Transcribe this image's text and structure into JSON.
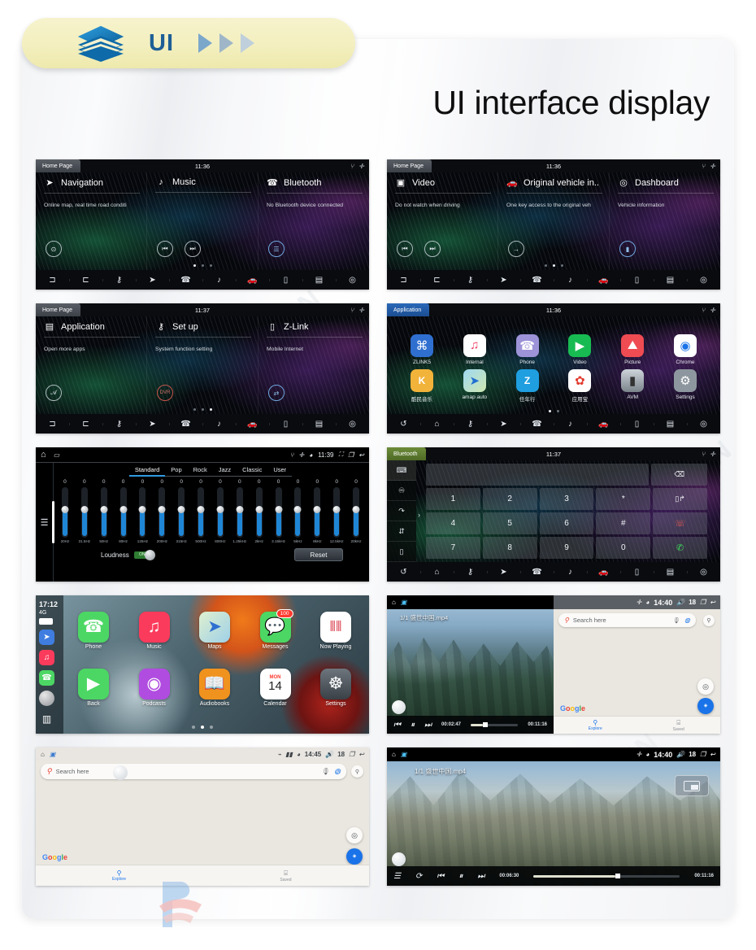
{
  "badge": {
    "label": "UI",
    "icon": "layers-stack-icon",
    "arrows": [
      "play-arrow-1",
      "play-arrow-2",
      "play-arrow-3"
    ]
  },
  "header": {
    "title": "UI interface display"
  },
  "watermarks": {
    "text": "ROADZHIYIN",
    "logo": "roadzhiyin-logo"
  },
  "screens": [
    {
      "id": "home-page-1",
      "tab": "Home Page",
      "clock": "11:36",
      "sysicons": [
        "usb-icon",
        "bluetooth-icon"
      ],
      "cards": [
        {
          "icon": "navigation-arrow-icon",
          "title": "Navigation",
          "sub": "Online map, real time road conditi",
          "buttons": [
            "location-pin-icon"
          ]
        },
        {
          "icon": "music-note-icon",
          "title": "Music",
          "sub": "",
          "buttons": [
            "prev-track-icon",
            "next-track-icon"
          ]
        },
        {
          "icon": "phone-handset-icon",
          "title": "Bluetooth",
          "sub": "No Bluetooth device connected",
          "buttons": [
            "call-list-icon"
          ]
        }
      ],
      "dots": 3,
      "active_dot": 0,
      "navbar": [
        "car-left-icon",
        "car-right-icon",
        "settings-key-icon",
        "navigation-icon",
        "phone-icon",
        "music-icon",
        "vehicle-icon",
        "link-phone-icon",
        "apps-icon",
        "dashboard-icon"
      ]
    },
    {
      "id": "home-page-2",
      "tab": "Home Page",
      "clock": "11:36",
      "sysicons": [
        "usb-icon",
        "bluetooth-icon"
      ],
      "cards": [
        {
          "icon": "video-icon",
          "title": "Video",
          "sub": "Do not watch when driving",
          "buttons": [
            "prev-track-icon",
            "next-track-icon"
          ]
        },
        {
          "icon": "vehicle-icon",
          "title": "Original vehicle in..",
          "sub": "One key access to the original veh",
          "buttons": [
            "exit-arrow-icon"
          ]
        },
        {
          "icon": "dashboard-icon",
          "title": "Dashboard",
          "sub": "Vehicle information",
          "buttons": [
            "equalizer-bars-icon"
          ]
        }
      ],
      "dots": 3,
      "active_dot": 1,
      "navbar": [
        "car-left-icon",
        "car-right-icon",
        "settings-key-icon",
        "navigation-icon",
        "phone-icon",
        "music-icon",
        "vehicle-icon",
        "link-phone-icon",
        "apps-icon",
        "dashboard-icon"
      ]
    },
    {
      "id": "home-page-3",
      "tab": "Home Page",
      "clock": "11:37",
      "sysicons": [
        "usb-icon",
        "bluetooth-icon"
      ],
      "cards": [
        {
          "icon": "apps-grid-icon",
          "title": "Application",
          "sub": "Open more apps",
          "buttons": [
            "app-store-icon"
          ]
        },
        {
          "icon": "settings-key-icon",
          "title": "Set up",
          "sub": "System function setting",
          "buttons": [
            "dvr-record-icon"
          ]
        },
        {
          "icon": "link-phone-icon",
          "title": "Z-Link",
          "sub": "Mobile Internet",
          "buttons": [
            "zlink-icon"
          ]
        }
      ],
      "dots": 3,
      "active_dot": 2,
      "navbar": [
        "car-left-icon",
        "car-right-icon",
        "settings-key-icon",
        "navigation-icon",
        "phone-icon",
        "music-icon",
        "vehicle-icon",
        "link-phone-icon",
        "apps-icon",
        "dashboard-icon"
      ]
    },
    {
      "id": "application-grid",
      "tab": "Application",
      "clock": "11:36",
      "sysicons": [
        "usb-icon",
        "bluetooth-icon"
      ],
      "apps": [
        [
          {
            "label": "ZLINK5",
            "icon": "zlink-car-icon",
            "color": "#2f6fd0",
            "glyph": "⌘"
          },
          {
            "label": "Internal",
            "icon": "music-note-icon",
            "color": "#ffffff",
            "glyph": "♫"
          },
          {
            "label": "Phone",
            "icon": "phone-icon",
            "color": "#9c93d8",
            "glyph": "☎"
          },
          {
            "label": "Video",
            "icon": "play-circle-icon",
            "color": "#18bb52",
            "glyph": "▶"
          },
          {
            "label": "Picture",
            "icon": "photo-icon",
            "color": "#ef4b52",
            "glyph": "⛰"
          },
          {
            "label": "Chrome",
            "icon": "chrome-icon",
            "color": "#ffffff",
            "glyph": "◉"
          }
        ],
        [
          {
            "label": "酷民音乐",
            "icon": "kuwo-music-icon",
            "color": "#f2b33a",
            "glyph": "K"
          },
          {
            "label": "amap auto",
            "icon": "amap-icon",
            "color": "#ffffff",
            "glyph": "➤"
          },
          {
            "label": "任年行",
            "icon": "rnx-icon",
            "color": "#1f9ee0",
            "glyph": "Z"
          },
          {
            "label": "应用宝",
            "icon": "tencent-appstore-icon",
            "color": "#ffffff",
            "glyph": "✿"
          },
          {
            "label": "AVM",
            "icon": "avm-camera-icon",
            "color": "#b9c0c7",
            "glyph": "⬛"
          },
          {
            "label": "Settings",
            "icon": "gear-icon",
            "color": "#8d969e",
            "glyph": "⚙"
          }
        ]
      ],
      "dots": 2,
      "active_dot": 0,
      "navbar": [
        "back-icon",
        "home-icon",
        "settings-key-icon",
        "navigation-icon",
        "phone-icon",
        "music-icon",
        "vehicle-icon",
        "link-phone-icon",
        "apps-icon",
        "dashboard-icon"
      ]
    },
    {
      "id": "equalizer",
      "statusbar": {
        "left_icons": [
          "home-icon",
          "dvr-icon"
        ],
        "right_icons": [
          "usb-icon",
          "bluetooth-icon",
          "wifi-icon"
        ],
        "clock": "11:39",
        "tail_icons": [
          "fullscreen-icon",
          "recent-apps-icon",
          "back-icon"
        ]
      },
      "presets": [
        "Standard",
        "Pop",
        "Rock",
        "Jazz",
        "Classic",
        "User"
      ],
      "selected_preset": "Standard",
      "values": [
        0,
        0,
        0,
        0,
        0,
        0,
        0,
        0,
        0,
        0,
        0,
        0,
        0,
        0,
        0,
        0
      ],
      "frequencies": [
        "20Hz",
        "31.5Hz",
        "50Hz",
        "80Hz",
        "125Hz",
        "200Hz",
        "315Hz",
        "500Hz",
        "800Hz",
        "1.25kHz",
        "2kHz",
        "3.15kHz",
        "5kHz",
        "8kHz",
        "12.5kHz",
        "20kHz"
      ],
      "loudness_label": "Loudness",
      "loudness_state": "ON",
      "reset_label": "Reset"
    },
    {
      "id": "bluetooth-dialer",
      "tab": "Bluetooth",
      "clock": "11:37",
      "sysicons": [
        "usb-icon",
        "bluetooth-icon"
      ],
      "sidebar": [
        "dialpad-icon",
        "contacts-icon",
        "call-history-icon",
        "sync-contacts-icon",
        "device-icon"
      ],
      "dial_value": "",
      "keys": [
        [
          "1",
          "2",
          "3",
          "*"
        ],
        [
          "4",
          "5",
          "6",
          "#"
        ],
        [
          "7",
          "8",
          "9",
          "0"
        ]
      ],
      "action_keys": [
        "backspace-icon",
        "transfer-call-icon",
        "hangup-icon",
        "call-icon"
      ],
      "navbar": [
        "back-icon",
        "home-icon",
        "settings-key-icon",
        "navigation-icon",
        "phone-icon",
        "music-icon",
        "vehicle-icon",
        "link-phone-icon",
        "apps-icon",
        "dashboard-icon"
      ]
    },
    {
      "id": "carplay-home",
      "status": {
        "time": "17:12",
        "signal": "4G",
        "battery": "battery-full-icon"
      },
      "side_apps": [
        "maps-mini-icon",
        "music-mini-icon",
        "phone-mini-icon",
        "siri-icon",
        "list-view-icon"
      ],
      "apps": [
        [
          {
            "label": "Phone",
            "icon": "phone-icon",
            "color": "#4cd764",
            "glyph": "☎"
          },
          {
            "label": "Music",
            "icon": "music-icon",
            "color": "#fb3b5c",
            "glyph": "♫"
          },
          {
            "label": "Maps",
            "icon": "maps-icon",
            "color": "#e8f3e0",
            "glyph": "➤"
          },
          {
            "label": "Messages",
            "icon": "messages-icon",
            "color": "#4cd764",
            "glyph": "●",
            "badge": "100"
          },
          {
            "label": "Now Playing",
            "icon": "now-playing-icon",
            "color": "#ffffff",
            "glyph": "‖"
          }
        ],
        [
          {
            "label": "Back",
            "icon": "back-play-icon",
            "color": "#4cd764",
            "glyph": "▶"
          },
          {
            "label": "Podcasts",
            "icon": "podcasts-icon",
            "color": "#b04ce0",
            "glyph": "Ⓐ"
          },
          {
            "label": "Audiobooks",
            "icon": "audiobooks-icon",
            "color": "#f0921e",
            "glyph": "◫"
          },
          {
            "label": "Calendar",
            "icon": "calendar-icon",
            "color": "#ffffff",
            "glyph": "14",
            "sublabel": "MON"
          },
          {
            "label": "Settings",
            "icon": "gear-icon",
            "color": "#8d969e",
            "glyph": "☸"
          }
        ]
      ],
      "dots": 3,
      "active_dot": 1
    },
    {
      "id": "split-video-maps",
      "video": {
        "status_icons": [
          "home-icon",
          "video-app-icon"
        ],
        "title": "1/1  盛世中国.mp4",
        "current_time": "00:02:47",
        "total_time": "00:11:16",
        "controls": [
          "prev-icon",
          "pause-icon",
          "next-icon"
        ]
      },
      "maps": {
        "status": {
          "icons": [
            "bluetooth-icon",
            "wifi-icon"
          ],
          "clock": "14:40",
          "volume": "18",
          "tail": [
            "recent-apps-icon",
            "back-icon"
          ]
        },
        "search_placeholder": "Search here",
        "search_icons": [
          "mic-icon",
          "assistant-icon",
          "compass-icon"
        ],
        "brand": "Google",
        "tabs": [
          {
            "label": "Explore",
            "icon": "pin-icon"
          },
          {
            "label": "Saved",
            "icon": "bookmark-icon"
          }
        ]
      }
    },
    {
      "id": "google-maps-full",
      "status": {
        "icons": [
          "home-icon",
          "maps-app-icon"
        ],
        "right": [
          "cast-icon",
          "signal-icon",
          "wifi-icon"
        ],
        "clock": "14:45",
        "volume": "18",
        "tail": [
          "recent-apps-icon",
          "back-icon"
        ]
      },
      "search_placeholder": "Search here",
      "search_icons": [
        "mic-icon",
        "assistant-icon",
        "compass-icon"
      ],
      "brand": "Google",
      "tabs": [
        {
          "label": "Explore",
          "icon": "pin-icon"
        },
        {
          "label": "Saved",
          "icon": "bookmark-icon"
        }
      ],
      "fabs": [
        "my-location-icon",
        "go-directions-icon"
      ]
    },
    {
      "id": "video-player-full",
      "status": {
        "icons": [
          "home-icon",
          "video-app-icon"
        ],
        "right": [
          "bluetooth-icon",
          "wifi-icon"
        ],
        "clock": "14:40",
        "volume": "18",
        "tail": [
          "recent-apps-icon",
          "back-icon"
        ]
      },
      "title": "1/1   盛世中国.mp4",
      "current_time": "00:06:30",
      "total_time": "00:11:16",
      "controls": [
        "playlist-icon",
        "repeat-icon",
        "prev-icon",
        "pause-icon",
        "next-icon"
      ],
      "pip_button": "picture-in-picture-icon"
    }
  ]
}
